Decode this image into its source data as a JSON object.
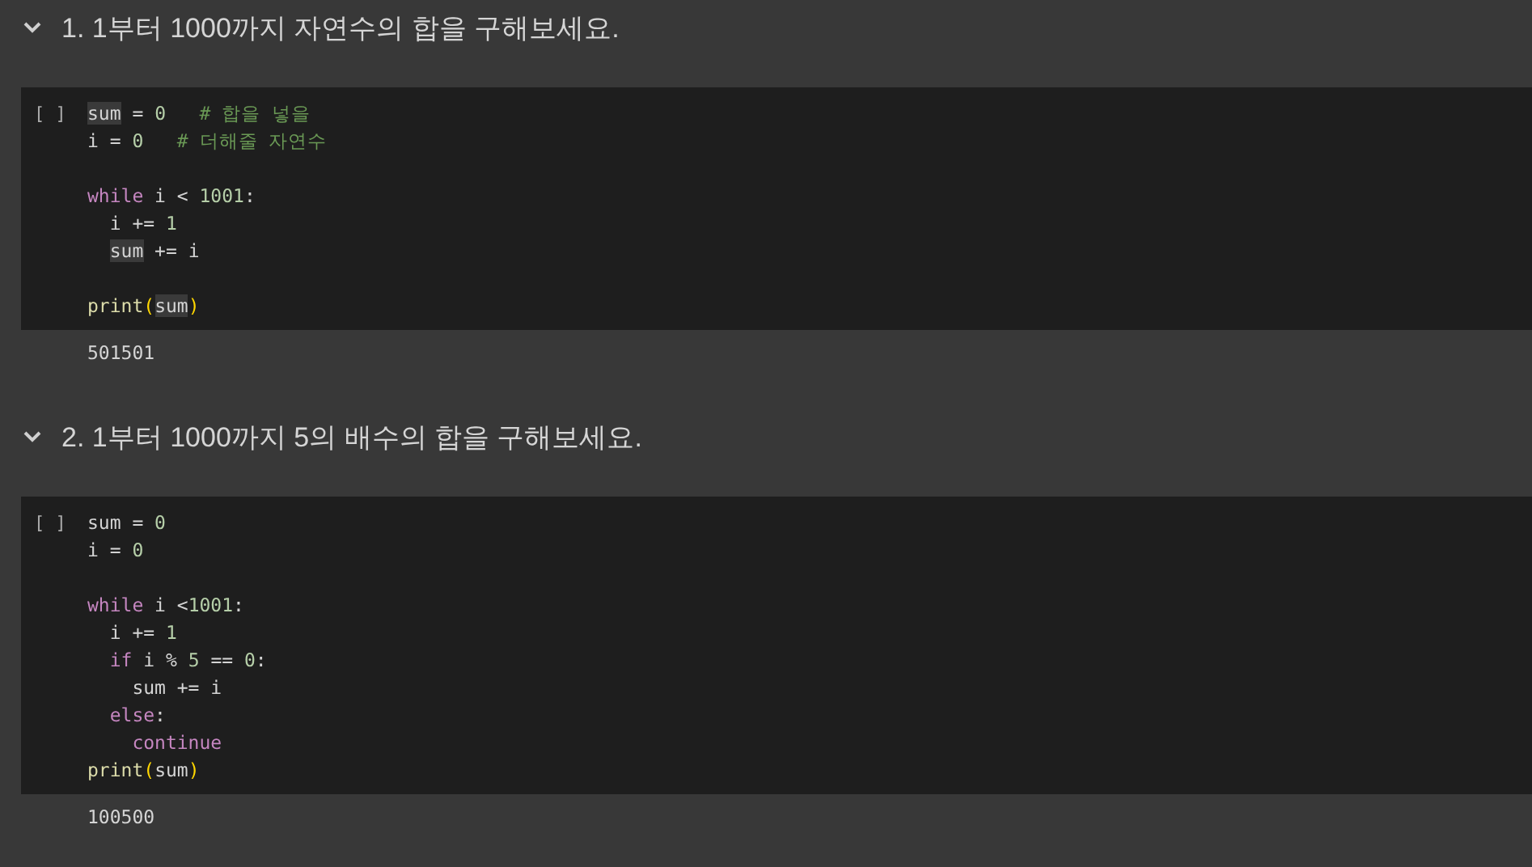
{
  "sections": [
    {
      "heading": "1. 1부터 1000까지 자연수의 합을 구해보세요.",
      "expanded": true,
      "run_marker": "[ ]",
      "code": [
        {
          "kind": "code",
          "tokens": [
            {
              "kind": "var-hl",
              "text": "sum"
            },
            {
              "kind": "plain",
              "text": " = "
            },
            {
              "kind": "number",
              "text": "0"
            },
            {
              "kind": "comment",
              "text": "# 합을 넣을",
              "gap": true
            }
          ]
        },
        {
          "kind": "code",
          "tokens": [
            {
              "kind": "plain",
              "text": "i = "
            },
            {
              "kind": "number",
              "text": "0"
            },
            {
              "kind": "comment",
              "text": "# 더해줄 자연수",
              "gap": true
            }
          ]
        },
        {
          "kind": "blank"
        },
        {
          "kind": "code",
          "tokens": [
            {
              "kind": "keyword",
              "text": "while"
            },
            {
              "kind": "plain",
              "text": " i < "
            },
            {
              "kind": "number",
              "text": "1001"
            },
            {
              "kind": "plain",
              "text": ":"
            }
          ],
          "children": [
            {
              "kind": "code",
              "tokens": [
                {
                  "kind": "plain",
                  "text": "i += "
                },
                {
                  "kind": "number",
                  "text": "1"
                }
              ]
            },
            {
              "kind": "code",
              "tokens": [
                {
                  "kind": "var-hl",
                  "text": "sum"
                },
                {
                  "kind": "plain",
                  "text": " += i"
                }
              ]
            }
          ]
        },
        {
          "kind": "blank"
        },
        {
          "kind": "code",
          "tokens": [
            {
              "kind": "func",
              "text": "print"
            },
            {
              "kind": "paren",
              "text": "("
            },
            {
              "kind": "var-hl",
              "text": "sum"
            },
            {
              "kind": "paren",
              "text": ")"
            }
          ]
        }
      ],
      "output": "501501"
    },
    {
      "heading": "2. 1부터 1000까지 5의 배수의 합을 구해보세요.",
      "expanded": true,
      "run_marker": "[ ]",
      "code": [
        {
          "kind": "code",
          "tokens": [
            {
              "kind": "plain",
              "text": "sum = "
            },
            {
              "kind": "number",
              "text": "0"
            }
          ]
        },
        {
          "kind": "code",
          "tokens": [
            {
              "kind": "plain",
              "text": "i = "
            },
            {
              "kind": "number",
              "text": "0"
            }
          ]
        },
        {
          "kind": "blank"
        },
        {
          "kind": "code",
          "tokens": [
            {
              "kind": "keyword",
              "text": "while"
            },
            {
              "kind": "plain",
              "text": " i <"
            },
            {
              "kind": "number",
              "text": "1001"
            },
            {
              "kind": "plain",
              "text": ":"
            }
          ],
          "children": [
            {
              "kind": "code",
              "tokens": [
                {
                  "kind": "plain",
                  "text": "i += "
                },
                {
                  "kind": "number",
                  "text": "1"
                }
              ]
            },
            {
              "kind": "code",
              "tokens": [
                {
                  "kind": "keyword",
                  "text": "if"
                },
                {
                  "kind": "plain",
                  "text": " i % "
                },
                {
                  "kind": "number",
                  "text": "5"
                },
                {
                  "kind": "plain",
                  "text": " == "
                },
                {
                  "kind": "number",
                  "text": "0"
                },
                {
                  "kind": "plain",
                  "text": ":"
                }
              ],
              "children": [
                {
                  "kind": "code",
                  "tokens": [
                    {
                      "kind": "plain",
                      "text": "sum += i"
                    }
                  ]
                }
              ]
            },
            {
              "kind": "code",
              "tokens": [
                {
                  "kind": "keyword",
                  "text": "else"
                },
                {
                  "kind": "plain",
                  "text": ":"
                }
              ],
              "children": [
                {
                  "kind": "code",
                  "tokens": [
                    {
                      "kind": "keyword",
                      "text": "continue"
                    }
                  ]
                }
              ]
            }
          ]
        },
        {
          "kind": "code",
          "tokens": [
            {
              "kind": "func",
              "text": "print"
            },
            {
              "kind": "paren",
              "text": "("
            },
            {
              "kind": "plain",
              "text": "sum"
            },
            {
              "kind": "paren",
              "text": ")"
            }
          ]
        }
      ],
      "output": "100500"
    }
  ]
}
